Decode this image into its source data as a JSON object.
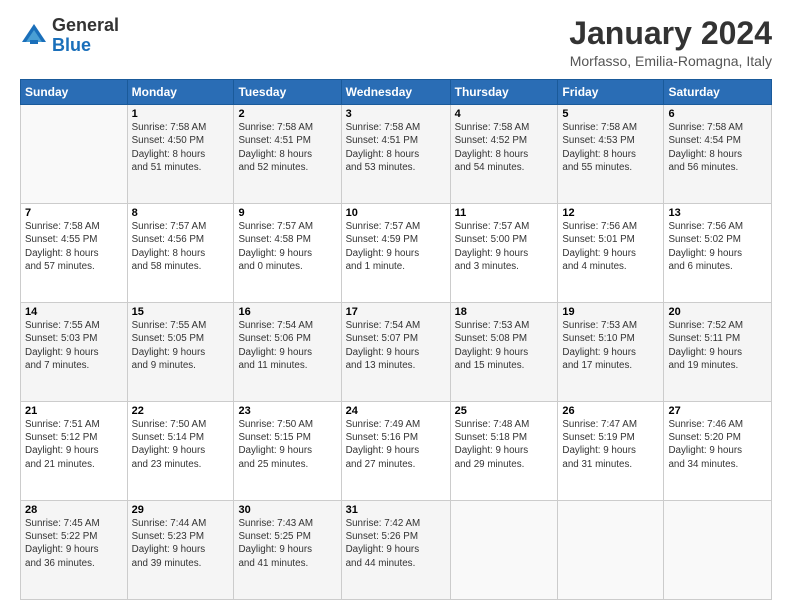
{
  "header": {
    "logo_line1": "General",
    "logo_line2": "Blue",
    "main_title": "January 2024",
    "subtitle": "Morfasso, Emilia-Romagna, Italy"
  },
  "calendar": {
    "days_of_week": [
      "Sunday",
      "Monday",
      "Tuesday",
      "Wednesday",
      "Thursday",
      "Friday",
      "Saturday"
    ],
    "weeks": [
      [
        {
          "day": "",
          "info": ""
        },
        {
          "day": "1",
          "info": "Sunrise: 7:58 AM\nSunset: 4:50 PM\nDaylight: 8 hours\nand 51 minutes."
        },
        {
          "day": "2",
          "info": "Sunrise: 7:58 AM\nSunset: 4:51 PM\nDaylight: 8 hours\nand 52 minutes."
        },
        {
          "day": "3",
          "info": "Sunrise: 7:58 AM\nSunset: 4:51 PM\nDaylight: 8 hours\nand 53 minutes."
        },
        {
          "day": "4",
          "info": "Sunrise: 7:58 AM\nSunset: 4:52 PM\nDaylight: 8 hours\nand 54 minutes."
        },
        {
          "day": "5",
          "info": "Sunrise: 7:58 AM\nSunset: 4:53 PM\nDaylight: 8 hours\nand 55 minutes."
        },
        {
          "day": "6",
          "info": "Sunrise: 7:58 AM\nSunset: 4:54 PM\nDaylight: 8 hours\nand 56 minutes."
        }
      ],
      [
        {
          "day": "7",
          "info": "Sunrise: 7:58 AM\nSunset: 4:55 PM\nDaylight: 8 hours\nand 57 minutes."
        },
        {
          "day": "8",
          "info": "Sunrise: 7:57 AM\nSunset: 4:56 PM\nDaylight: 8 hours\nand 58 minutes."
        },
        {
          "day": "9",
          "info": "Sunrise: 7:57 AM\nSunset: 4:58 PM\nDaylight: 9 hours\nand 0 minutes."
        },
        {
          "day": "10",
          "info": "Sunrise: 7:57 AM\nSunset: 4:59 PM\nDaylight: 9 hours\nand 1 minute."
        },
        {
          "day": "11",
          "info": "Sunrise: 7:57 AM\nSunset: 5:00 PM\nDaylight: 9 hours\nand 3 minutes."
        },
        {
          "day": "12",
          "info": "Sunrise: 7:56 AM\nSunset: 5:01 PM\nDaylight: 9 hours\nand 4 minutes."
        },
        {
          "day": "13",
          "info": "Sunrise: 7:56 AM\nSunset: 5:02 PM\nDaylight: 9 hours\nand 6 minutes."
        }
      ],
      [
        {
          "day": "14",
          "info": "Sunrise: 7:55 AM\nSunset: 5:03 PM\nDaylight: 9 hours\nand 7 minutes."
        },
        {
          "day": "15",
          "info": "Sunrise: 7:55 AM\nSunset: 5:05 PM\nDaylight: 9 hours\nand 9 minutes."
        },
        {
          "day": "16",
          "info": "Sunrise: 7:54 AM\nSunset: 5:06 PM\nDaylight: 9 hours\nand 11 minutes."
        },
        {
          "day": "17",
          "info": "Sunrise: 7:54 AM\nSunset: 5:07 PM\nDaylight: 9 hours\nand 13 minutes."
        },
        {
          "day": "18",
          "info": "Sunrise: 7:53 AM\nSunset: 5:08 PM\nDaylight: 9 hours\nand 15 minutes."
        },
        {
          "day": "19",
          "info": "Sunrise: 7:53 AM\nSunset: 5:10 PM\nDaylight: 9 hours\nand 17 minutes."
        },
        {
          "day": "20",
          "info": "Sunrise: 7:52 AM\nSunset: 5:11 PM\nDaylight: 9 hours\nand 19 minutes."
        }
      ],
      [
        {
          "day": "21",
          "info": "Sunrise: 7:51 AM\nSunset: 5:12 PM\nDaylight: 9 hours\nand 21 minutes."
        },
        {
          "day": "22",
          "info": "Sunrise: 7:50 AM\nSunset: 5:14 PM\nDaylight: 9 hours\nand 23 minutes."
        },
        {
          "day": "23",
          "info": "Sunrise: 7:50 AM\nSunset: 5:15 PM\nDaylight: 9 hours\nand 25 minutes."
        },
        {
          "day": "24",
          "info": "Sunrise: 7:49 AM\nSunset: 5:16 PM\nDaylight: 9 hours\nand 27 minutes."
        },
        {
          "day": "25",
          "info": "Sunrise: 7:48 AM\nSunset: 5:18 PM\nDaylight: 9 hours\nand 29 minutes."
        },
        {
          "day": "26",
          "info": "Sunrise: 7:47 AM\nSunset: 5:19 PM\nDaylight: 9 hours\nand 31 minutes."
        },
        {
          "day": "27",
          "info": "Sunrise: 7:46 AM\nSunset: 5:20 PM\nDaylight: 9 hours\nand 34 minutes."
        }
      ],
      [
        {
          "day": "28",
          "info": "Sunrise: 7:45 AM\nSunset: 5:22 PM\nDaylight: 9 hours\nand 36 minutes."
        },
        {
          "day": "29",
          "info": "Sunrise: 7:44 AM\nSunset: 5:23 PM\nDaylight: 9 hours\nand 39 minutes."
        },
        {
          "day": "30",
          "info": "Sunrise: 7:43 AM\nSunset: 5:25 PM\nDaylight: 9 hours\nand 41 minutes."
        },
        {
          "day": "31",
          "info": "Sunrise: 7:42 AM\nSunset: 5:26 PM\nDaylight: 9 hours\nand 44 minutes."
        },
        {
          "day": "",
          "info": ""
        },
        {
          "day": "",
          "info": ""
        },
        {
          "day": "",
          "info": ""
        }
      ]
    ]
  }
}
